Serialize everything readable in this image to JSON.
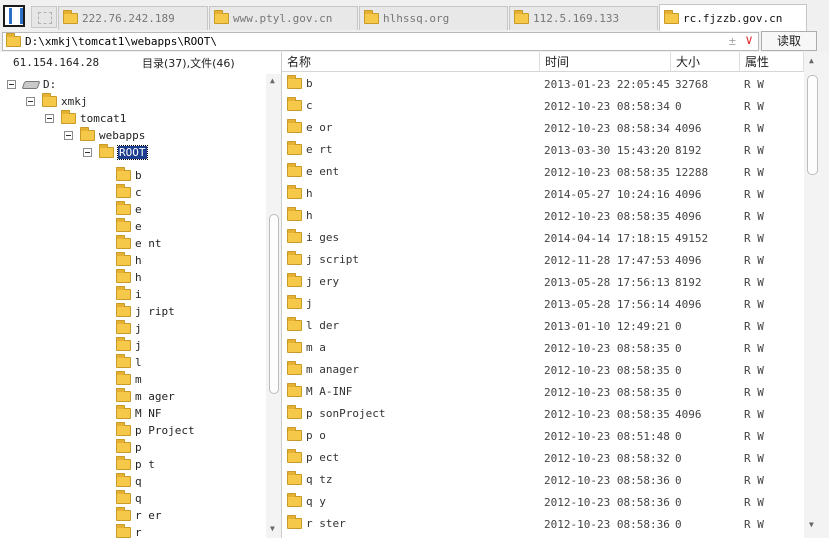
{
  "tabs": [
    {
      "label": "222.76.242.189",
      "active": false
    },
    {
      "label": "www.ptyl.gov.cn",
      "active": false
    },
    {
      "label": "hlhssq.org",
      "active": false
    },
    {
      "label": "112.5.169.133",
      "active": false
    },
    {
      "label": "rc.fjzzb.gov.cn",
      "active": true
    }
  ],
  "address": {
    "path": "D:\\xmkj\\tomcat1\\webapps\\ROOT\\",
    "plus": "±",
    "chevron": "∨",
    "read_button": "读取"
  },
  "left": {
    "ip": "61.154.164.28",
    "counts": "目录(37),文件(46)",
    "tree": [
      {
        "label": "D:",
        "kind": "drive"
      },
      {
        "label": "xmkj"
      },
      {
        "label": "tomcat1"
      },
      {
        "label": "webapps"
      },
      {
        "label": "ROOT",
        "selected": true
      }
    ],
    "children": [
      "b",
      "c",
      "e",
      "e",
      "e           nt",
      "h",
      "h",
      "i",
      "j    ript",
      "j",
      "j",
      "l",
      "m",
      "m    ager",
      "M    NF",
      "p    Project",
      "p",
      "p    t",
      "q",
      "q",
      "r    er",
      "r"
    ]
  },
  "columns": {
    "name": "名称",
    "time": "时间",
    "size": "大小",
    "attr": "属性"
  },
  "rows": [
    {
      "name": "b",
      "time": "2013-01-23 22:05:45",
      "size": "32768",
      "attr": "R W"
    },
    {
      "name": "c",
      "time": "2012-10-23 08:58:34",
      "size": "0",
      "attr": "R W"
    },
    {
      "name": "e    or",
      "time": "2012-10-23 08:58:34",
      "size": "4096",
      "attr": "R W"
    },
    {
      "name": "e    rt",
      "time": "2013-03-30 15:43:20",
      "size": "8192",
      "attr": "R W"
    },
    {
      "name": "e              ent",
      "time": "2012-10-23 08:58:35",
      "size": "12288",
      "attr": "R W"
    },
    {
      "name": "h",
      "time": "2014-05-27 10:24:16",
      "size": "4096",
      "attr": "R W"
    },
    {
      "name": "h",
      "time": "2012-10-23 08:58:35",
      "size": "4096",
      "attr": "R W"
    },
    {
      "name": "i    ges",
      "time": "2014-04-14 17:18:15",
      "size": "49152",
      "attr": "R W"
    },
    {
      "name": "j    script",
      "time": "2012-11-28 17:47:53",
      "size": "4096",
      "attr": "R W"
    },
    {
      "name": "j    ery",
      "time": "2013-05-28 17:56:13",
      "size": "8192",
      "attr": "R W"
    },
    {
      "name": "j",
      "time": "2013-05-28 17:56:14",
      "size": "4096",
      "attr": "R W"
    },
    {
      "name": "l    der",
      "time": "2013-01-10 12:49:21",
      "size": "0",
      "attr": "R W"
    },
    {
      "name": "m    a",
      "time": "2012-10-23 08:58:35",
      "size": "0",
      "attr": "R W"
    },
    {
      "name": "m    anager",
      "time": "2012-10-23 08:58:35",
      "size": "0",
      "attr": "R W"
    },
    {
      "name": "M    A-INF",
      "time": "2012-10-23 08:58:35",
      "size": "0",
      "attr": "R W"
    },
    {
      "name": "p        sonProject",
      "time": "2012-10-23 08:58:35",
      "size": "4096",
      "attr": "R W"
    },
    {
      "name": "p    o",
      "time": "2012-10-23 08:51:48",
      "size": "0",
      "attr": "R W"
    },
    {
      "name": "p    ect",
      "time": "2012-10-23 08:58:32",
      "size": "0",
      "attr": "R W"
    },
    {
      "name": "q    tz",
      "time": "2012-10-23 08:58:36",
      "size": "0",
      "attr": "R W"
    },
    {
      "name": "q    y",
      "time": "2012-10-23 08:58:36",
      "size": "0",
      "attr": "R W"
    },
    {
      "name": "r    ster",
      "time": "2012-10-23 08:58:36",
      "size": "0",
      "attr": "R W"
    }
  ]
}
